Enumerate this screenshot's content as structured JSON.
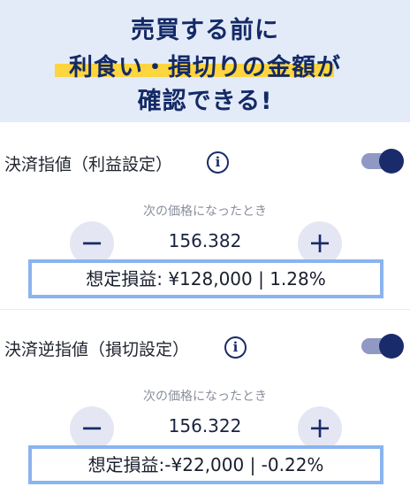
{
  "banner": {
    "line1": "売買する前に",
    "line2": "利食い・損切りの金額が",
    "line3": "確認できる!"
  },
  "take_profit": {
    "label": "決済指値（利益設定）",
    "info_glyph": "i",
    "enabled": true,
    "condition": "次の価格になったとき",
    "minus_label": "−",
    "plus_label": "+",
    "price": "156.382",
    "estimate": "想定損益: ¥128,000 | 1.28%"
  },
  "stop_loss": {
    "label": "決済逆指値（損切設定）",
    "info_glyph": "i",
    "enabled": true,
    "condition": "次の価格になったとき",
    "minus_label": "−",
    "plus_label": "+",
    "price": "156.322",
    "estimate": "想定損益:-¥22,000 | -0.22%"
  },
  "colors": {
    "banner_bg": "#e3ebf9",
    "highlight": "#fdd53f",
    "accent": "#1a2b6b",
    "box_border": "#8ab4ef"
  }
}
